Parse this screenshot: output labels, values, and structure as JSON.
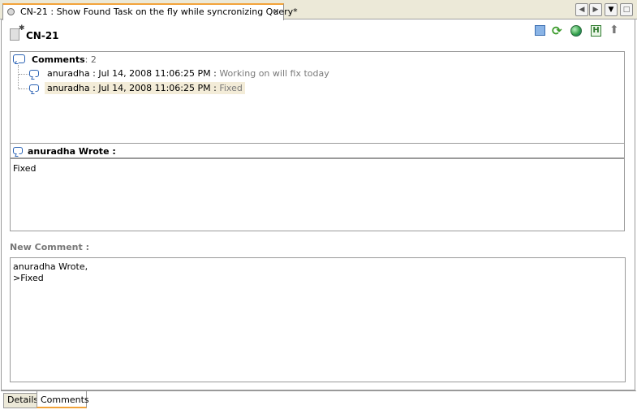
{
  "window": {
    "tab_title": "CN-21 : Show Found Task on the fly while syncronizing Query*",
    "close_glyph": "x"
  },
  "header": {
    "task_id": "CN-21",
    "toolbar_icons": [
      "stop-icon",
      "sync-icon",
      "open-in-browser-icon",
      "help-icon",
      "export-icon"
    ]
  },
  "comments_tree": {
    "root_label": "Comments",
    "root_count": ": 2",
    "items": [
      {
        "meta": "anuradha : Jul 14, 2008 11:06:25 PM : ",
        "message": "Working on will fix today"
      },
      {
        "meta": "anuradha : Jul 14, 2008 11:06:25 PM : ",
        "message": "Fixed"
      }
    ]
  },
  "selected_comment": {
    "header": "anuradha Wrote :",
    "body": "Fixed"
  },
  "new_comment": {
    "label": "New Comment :",
    "value": "anuradha Wrote,\n>Fixed\n\n"
  },
  "bottom_tabs": [
    {
      "label": "Details",
      "active": false
    },
    {
      "label": "Comments",
      "active": true
    }
  ],
  "colors": {
    "accent_tab": "#f2a33a",
    "icon_blue": "#2a62b4",
    "selected_row": "#f3ecd8"
  }
}
